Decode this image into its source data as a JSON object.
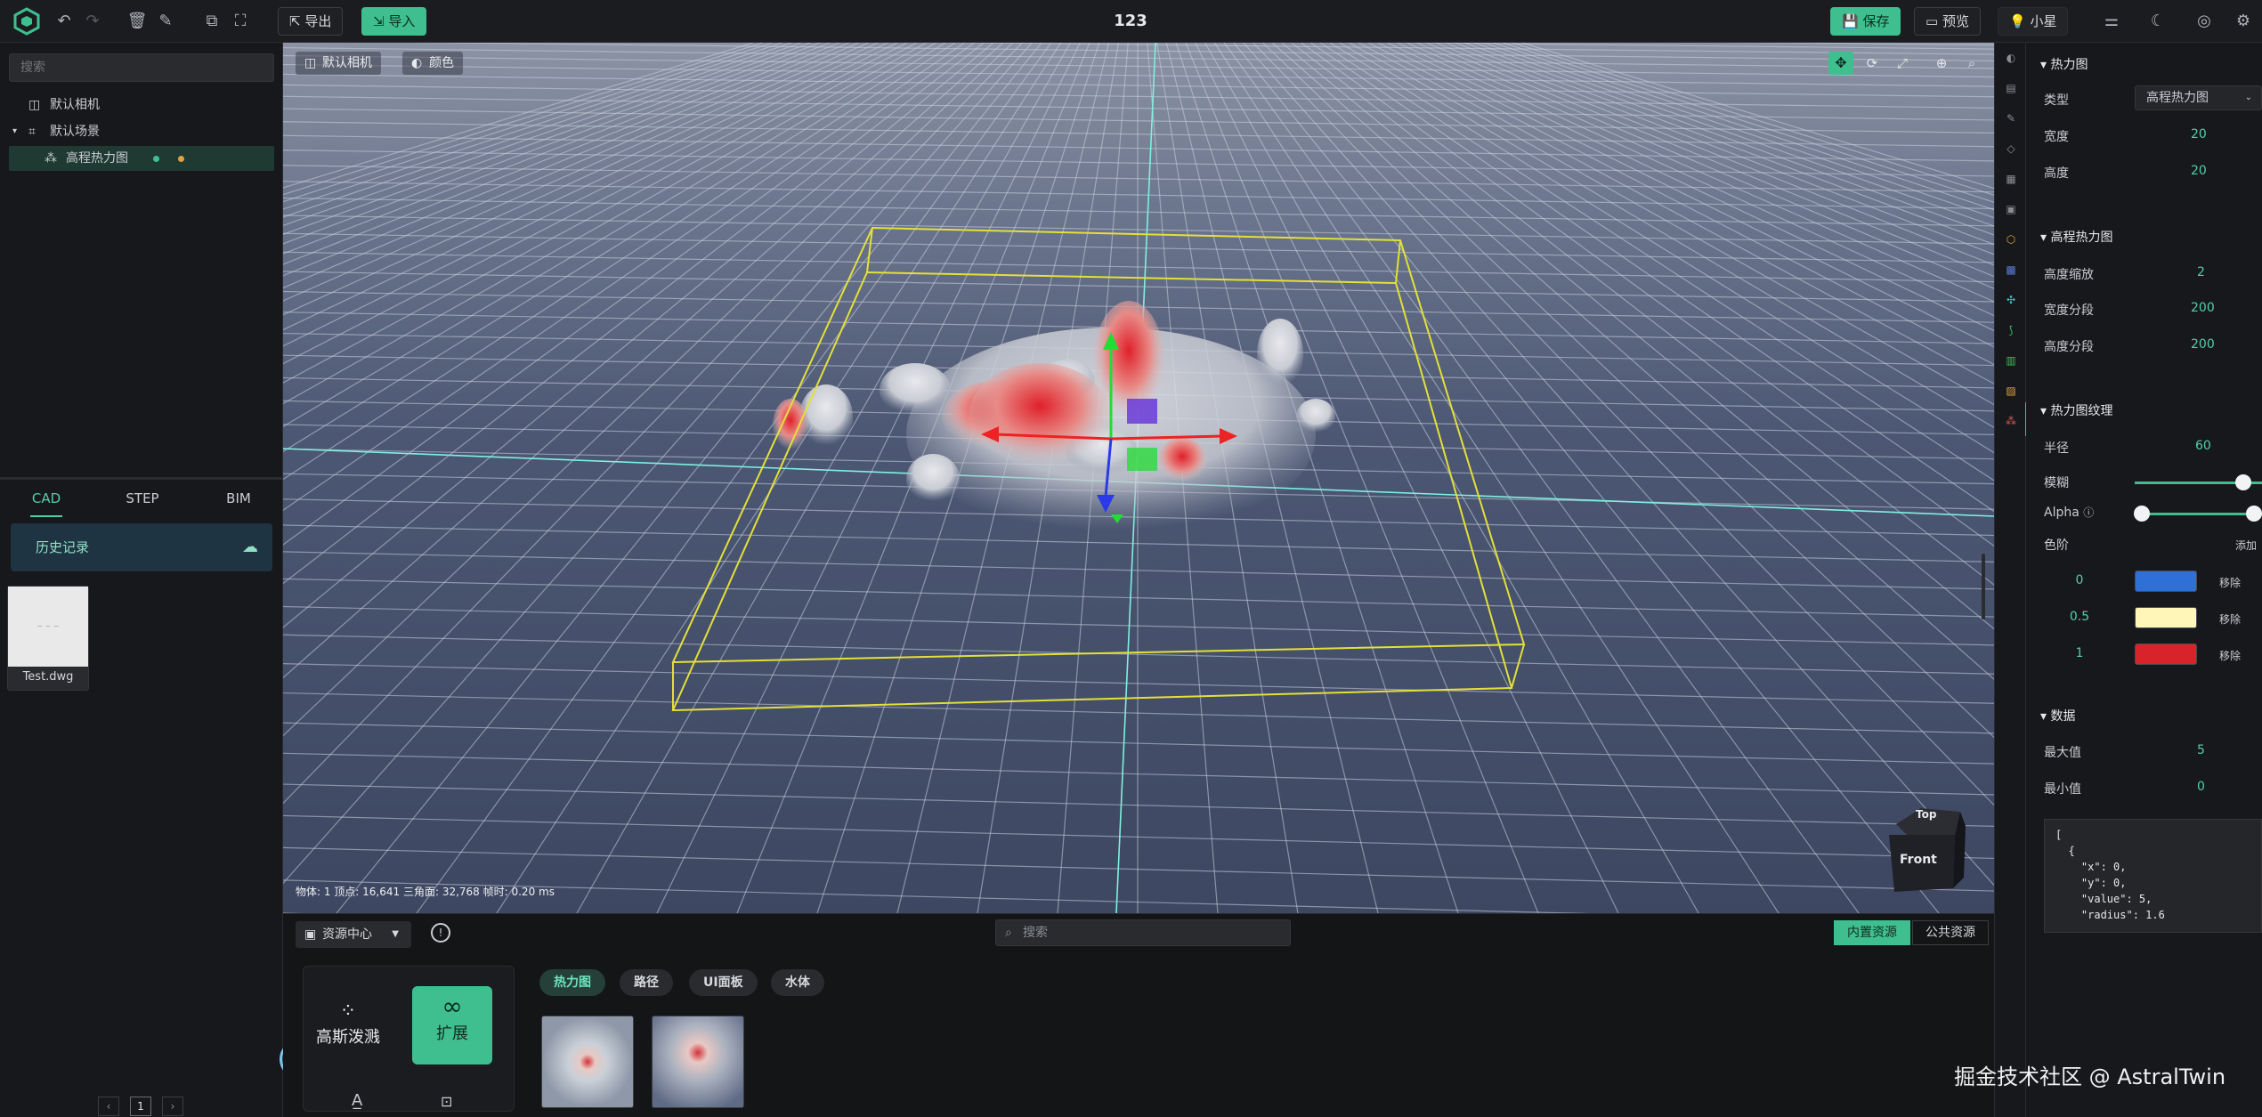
{
  "app": {
    "title": "123"
  },
  "toolbar": {
    "export_label": "导出",
    "import_label": "导入",
    "save_label": "保存",
    "preview_label": "预览",
    "user_label": "小星"
  },
  "left": {
    "search_placeholder": "搜索",
    "tree": [
      {
        "label": "默认相机"
      },
      {
        "label": "默认场景"
      },
      {
        "label": "高程热力图"
      }
    ],
    "tabs": [
      "CAD",
      "STEP",
      "BIM"
    ],
    "history_label": "历史记录",
    "file_name": "Test.dwg",
    "page_number": "1"
  },
  "viewport": {
    "camera_label": "默认相机",
    "color_label": "颜色",
    "stats_text": "物体: 1  顶点: 16,641  三角面: 32,768  帧时: 0.20 ms",
    "cube_top": "Top",
    "cube_front": "Front"
  },
  "bottom": {
    "resource_center_label": "资源中心",
    "search_placeholder": "搜索",
    "builtin_label": "内置资源",
    "public_label": "公共资源",
    "categories": {
      "gaussian_label": "高斯泼溅",
      "extend_label": "扩展"
    },
    "chips": [
      "热力图",
      "路径",
      "UI面板",
      "水体"
    ]
  },
  "props": {
    "heatmap_section": "热力图",
    "type_label": "类型",
    "type_value": "高程热力图",
    "width_label": "宽度",
    "width_value": "20",
    "height_label": "高度",
    "height_value": "20",
    "elev_section": "高程热力图",
    "height_scale_label": "高度缩放",
    "height_scale_value": "2",
    "width_seg_label": "宽度分段",
    "width_seg_value": "200",
    "height_seg_label": "高度分段",
    "height_seg_value": "200",
    "texture_section": "热力图纹理",
    "radius_label": "半径",
    "radius_value": "60",
    "blur_label": "模糊",
    "blur_level": 0.85,
    "alpha_label": "Alpha",
    "alpha_min": 0.0,
    "alpha_max": 1.0,
    "gradient_label": "色阶",
    "add_label": "添加",
    "remove_label": "移除",
    "stops": [
      {
        "pos": "0",
        "color": "#2f6fd8"
      },
      {
        "pos": "0.5",
        "color": "#fff6b8"
      },
      {
        "pos": "1",
        "color": "#d8232a"
      }
    ],
    "data_section": "数据",
    "max_label": "最大值",
    "max_value": "5",
    "min_label": "最小值",
    "min_value": "0",
    "json_text": "[\n  {\n    \"x\": 0,\n    \"y\": 0,\n    \"value\": 5,\n    \"radius\": 1.6"
  },
  "watermark": "掘金技术社区 @ AstralTwin",
  "colors": {
    "accent": "#3fbf8f",
    "bbox": "#e3e03a"
  }
}
